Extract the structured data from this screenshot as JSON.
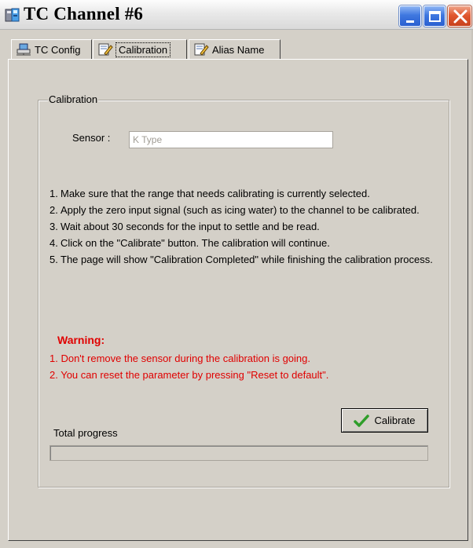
{
  "window": {
    "title": "TC Channel #6",
    "controls": {
      "minimize": "minimize",
      "maximize": "maximize",
      "close": "close"
    }
  },
  "tabs": [
    {
      "label": "TC Config",
      "icon": "network-config-icon",
      "active": false
    },
    {
      "label": "Calibration",
      "icon": "edit-pencil-icon",
      "active": true
    },
    {
      "label": "Alias Name",
      "icon": "edit-pencil-icon",
      "active": false
    }
  ],
  "calibration": {
    "group_title": "Calibration",
    "sensor_label": "Sensor :",
    "sensor_value": "K Type",
    "steps": [
      {
        "num": "1.",
        "text": "Make sure that the range that needs calibrating is currently selected."
      },
      {
        "num": "2.",
        "text": "Apply the zero input signal (such as icing water) to the channel to be calibrated."
      },
      {
        "num": "3.",
        "text": "Wait about 30 seconds for the input to settle and be read."
      },
      {
        "num": "4.",
        "text": "Click on the \"Calibrate\" button. The calibration will continue."
      },
      {
        "num": "5.",
        "text": "The page will show \"Calibration Completed\" while finishing the calibration process."
      }
    ],
    "warning_title": "Warning:",
    "warnings": [
      "1. Don't remove the sensor during the calibration is going.",
      "2. You can reset the parameter by pressing \"Reset to default\"."
    ],
    "calibrate_button": "Calibrate",
    "progress_label": "Total progress",
    "progress_value": 0
  },
  "colors": {
    "warning": "#e00000",
    "window_bg": "#d4d0c8",
    "titlebar_button": "#3f78e0",
    "close_button": "#e1582f",
    "check_icon": "#2f9e2a"
  }
}
